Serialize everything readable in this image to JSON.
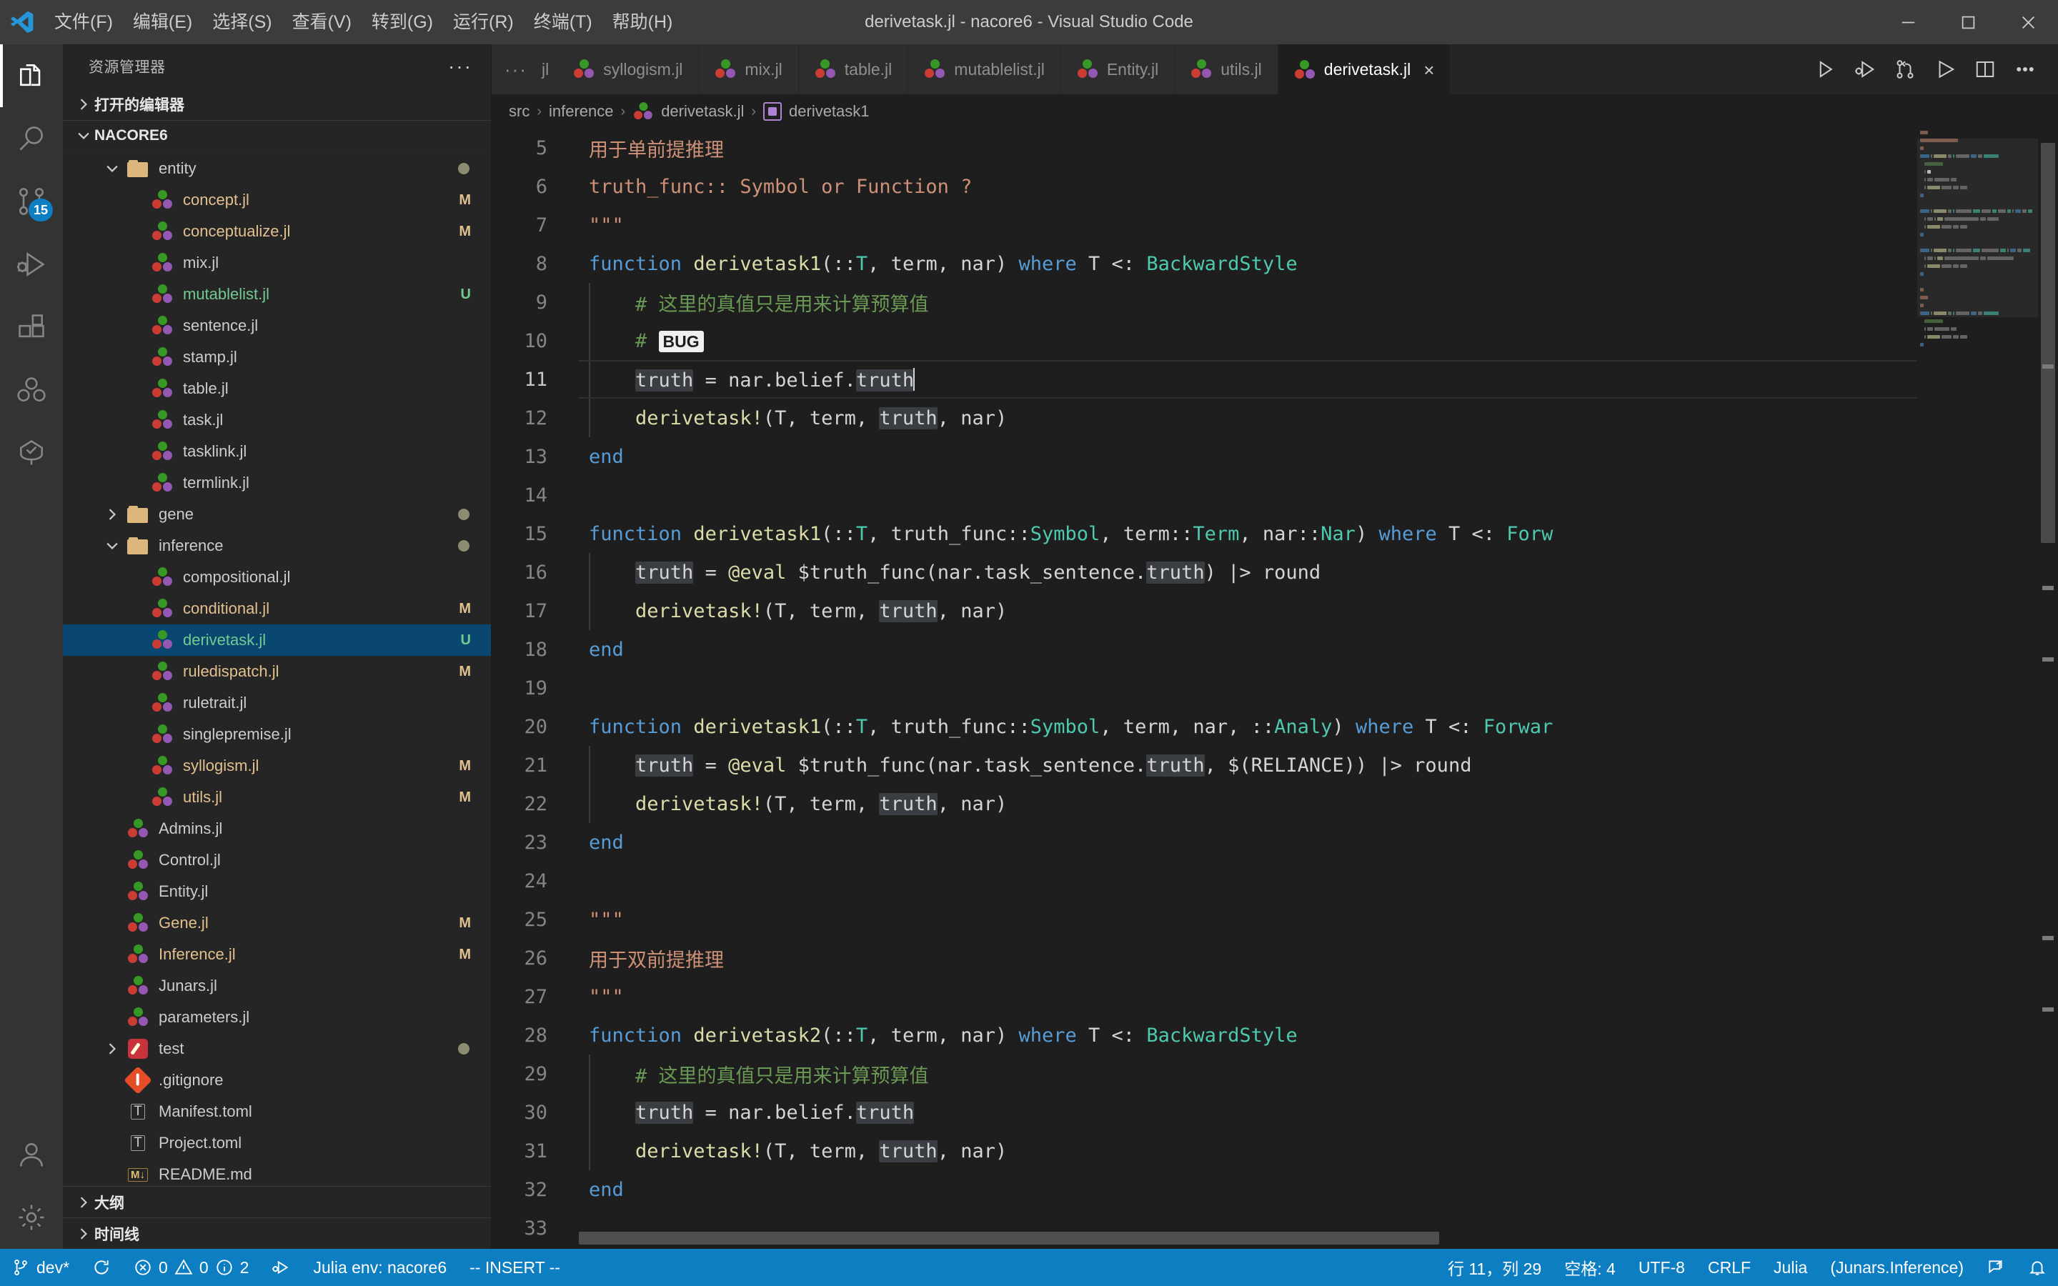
{
  "window": {
    "title": "derivetask.jl - nacore6 - Visual Studio Code",
    "menu": [
      "文件(F)",
      "编辑(E)",
      "选择(S)",
      "查看(V)",
      "转到(G)",
      "运行(R)",
      "终端(T)",
      "帮助(H)"
    ],
    "controls": {
      "minimize": "minimize-icon",
      "maximize": "maximize-icon",
      "close": "close-icon"
    }
  },
  "activity_bar": {
    "items": [
      {
        "name": "explorer",
        "icon": "files-icon",
        "active": true,
        "badge": ""
      },
      {
        "name": "search",
        "icon": "search-icon",
        "active": false,
        "badge": ""
      },
      {
        "name": "source-control",
        "icon": "source-control-icon",
        "active": false,
        "badge": "15"
      },
      {
        "name": "run-and-debug",
        "icon": "run-debug-icon",
        "active": false,
        "badge": ""
      },
      {
        "name": "extensions",
        "icon": "extensions-icon",
        "active": false,
        "badge": ""
      },
      {
        "name": "julia",
        "icon": "julia-icon",
        "active": false,
        "badge": ""
      },
      {
        "name": "testing",
        "icon": "testing-tree-icon",
        "active": false,
        "badge": ""
      }
    ],
    "bottom": [
      {
        "name": "accounts",
        "icon": "account-icon"
      },
      {
        "name": "manage",
        "icon": "gear-icon"
      }
    ]
  },
  "sidebar": {
    "title": "资源管理器",
    "more_actions": "···",
    "open_editors_label": "打开的编辑器",
    "folder_label": "NACORE6",
    "outline_label": "大纲",
    "timeline_label": "时间线",
    "tree": [
      {
        "label": "entity",
        "type": "folder",
        "indent": 1,
        "expanded": true,
        "status": "",
        "dot": true
      },
      {
        "label": "concept.jl",
        "type": "julia",
        "indent": 2,
        "status": "M"
      },
      {
        "label": "conceptualize.jl",
        "type": "julia",
        "indent": 2,
        "status": "M"
      },
      {
        "label": "mix.jl",
        "type": "julia",
        "indent": 2,
        "status": ""
      },
      {
        "label": "mutablelist.jl",
        "type": "julia",
        "indent": 2,
        "status": "U",
        "color": "#73c991"
      },
      {
        "label": "sentence.jl",
        "type": "julia",
        "indent": 2,
        "status": ""
      },
      {
        "label": "stamp.jl",
        "type": "julia",
        "indent": 2,
        "status": ""
      },
      {
        "label": "table.jl",
        "type": "julia",
        "indent": 2,
        "status": ""
      },
      {
        "label": "task.jl",
        "type": "julia",
        "indent": 2,
        "status": ""
      },
      {
        "label": "tasklink.jl",
        "type": "julia",
        "indent": 2,
        "status": ""
      },
      {
        "label": "termlink.jl",
        "type": "julia",
        "indent": 2,
        "status": ""
      },
      {
        "label": "gene",
        "type": "folder",
        "indent": 1,
        "expanded": false,
        "status": "",
        "dot": true
      },
      {
        "label": "inference",
        "type": "folder",
        "indent": 1,
        "expanded": true,
        "status": "",
        "dot": true
      },
      {
        "label": "compositional.jl",
        "type": "julia",
        "indent": 2,
        "status": ""
      },
      {
        "label": "conditional.jl",
        "type": "julia",
        "indent": 2,
        "status": "M"
      },
      {
        "label": "derivetask.jl",
        "type": "julia",
        "indent": 2,
        "status": "U",
        "selected": true,
        "color": "#73c991"
      },
      {
        "label": "ruledispatch.jl",
        "type": "julia",
        "indent": 2,
        "status": "M"
      },
      {
        "label": "ruletrait.jl",
        "type": "julia",
        "indent": 2,
        "status": ""
      },
      {
        "label": "singlepremise.jl",
        "type": "julia",
        "indent": 2,
        "status": ""
      },
      {
        "label": "syllogism.jl",
        "type": "julia",
        "indent": 2,
        "status": "M"
      },
      {
        "label": "utils.jl",
        "type": "julia",
        "indent": 2,
        "status": "M"
      },
      {
        "label": "Admins.jl",
        "type": "julia",
        "indent": 1,
        "status": ""
      },
      {
        "label": "Control.jl",
        "type": "julia",
        "indent": 1,
        "status": ""
      },
      {
        "label": "Entity.jl",
        "type": "julia",
        "indent": 1,
        "status": ""
      },
      {
        "label": "Gene.jl",
        "type": "julia",
        "indent": 1,
        "status": "M"
      },
      {
        "label": "Inference.jl",
        "type": "julia",
        "indent": 1,
        "status": "M"
      },
      {
        "label": "Junars.jl",
        "type": "julia",
        "indent": 1,
        "status": ""
      },
      {
        "label": "parameters.jl",
        "type": "julia",
        "indent": 1,
        "status": ""
      },
      {
        "label": "test",
        "type": "test",
        "indent": 1,
        "expanded": false,
        "status": "",
        "dot": true
      },
      {
        "label": ".gitignore",
        "type": "git",
        "indent": 1,
        "status": ""
      },
      {
        "label": "Manifest.toml",
        "type": "toml",
        "indent": 1,
        "status": ""
      },
      {
        "label": "Project.toml",
        "type": "toml",
        "indent": 1,
        "status": ""
      },
      {
        "label": "README.md",
        "type": "md",
        "indent": 1,
        "status": ""
      }
    ]
  },
  "tabs": {
    "overflow_indicator": "···",
    "truncated_tab": "jl",
    "items": [
      {
        "label": "syllogism.jl",
        "active": false
      },
      {
        "label": "mix.jl",
        "active": false
      },
      {
        "label": "table.jl",
        "active": false
      },
      {
        "label": "mutablelist.jl",
        "active": false
      },
      {
        "label": "Entity.jl",
        "active": false
      },
      {
        "label": "utils.jl",
        "active": false
      },
      {
        "label": "derivetask.jl",
        "active": true,
        "close": "×"
      }
    ],
    "actions": [
      {
        "name": "run-file-button",
        "icon": "play-icon"
      },
      {
        "name": "debug-file-button",
        "icon": "debug-play-icon"
      },
      {
        "name": "julia-repl-button",
        "icon": "source-control-icon"
      },
      {
        "name": "run-or-play-button",
        "icon": "play-filled-icon"
      },
      {
        "name": "split-editor-button",
        "icon": "split-editor-icon"
      },
      {
        "name": "more-actions-button",
        "icon": "ellipsis-icon"
      }
    ]
  },
  "breadcrumb": {
    "parts": [
      "src",
      "inference",
      "derivetask.jl",
      "derivetask1"
    ],
    "separator": "›"
  },
  "editor": {
    "first_line": 5,
    "cursor_line": 11,
    "lines": [
      {
        "n": 5,
        "tokens": [
          {
            "t": "用于单前提推理",
            "c": "str"
          }
        ]
      },
      {
        "n": 6,
        "tokens": [
          {
            "t": "truth_func:: Symbol or Function ?",
            "c": "str"
          }
        ]
      },
      {
        "n": 7,
        "tokens": [
          {
            "t": "\"\"\"",
            "c": "str"
          }
        ]
      },
      {
        "n": 8,
        "tokens": [
          {
            "t": "function",
            "c": "k"
          },
          {
            "t": " ",
            "c": "pl"
          },
          {
            "t": "derivetask1",
            "c": "fn"
          },
          {
            "t": "(::",
            "c": "pl"
          },
          {
            "t": "T",
            "c": "ty"
          },
          {
            "t": ", term, nar) ",
            "c": "pl"
          },
          {
            "t": "where",
            "c": "k"
          },
          {
            "t": " T <: ",
            "c": "pl"
          },
          {
            "t": "BackwardStyle",
            "c": "ty"
          }
        ]
      },
      {
        "n": 9,
        "indent": true,
        "tokens": [
          {
            "t": "    # 这里的真值只是用来计算预算值",
            "c": "cm"
          }
        ]
      },
      {
        "n": 10,
        "indent": true,
        "tokens": [
          {
            "t": "    # ",
            "c": "cm"
          },
          {
            "t": "BUG",
            "c": "bugtag"
          }
        ]
      },
      {
        "n": 11,
        "indent": true,
        "cursor": true,
        "tokens": [
          {
            "t": "    ",
            "c": "pl"
          },
          {
            "t": "truth",
            "c": "pl hl"
          },
          {
            "t": " = nar.belief.",
            "c": "pl"
          },
          {
            "t": "truth",
            "c": "pl hl"
          },
          {
            "t": "|CARET|",
            "c": "caret"
          }
        ]
      },
      {
        "n": 12,
        "indent": true,
        "tokens": [
          {
            "t": "    ",
            "c": "pl"
          },
          {
            "t": "derivetask!",
            "c": "fn"
          },
          {
            "t": "(T, term, ",
            "c": "pl"
          },
          {
            "t": "truth",
            "c": "pl hl"
          },
          {
            "t": ", nar)",
            "c": "pl"
          }
        ]
      },
      {
        "n": 13,
        "tokens": [
          {
            "t": "end",
            "c": "k"
          }
        ]
      },
      {
        "n": 14,
        "tokens": []
      },
      {
        "n": 15,
        "tokens": [
          {
            "t": "function",
            "c": "k"
          },
          {
            "t": " ",
            "c": "pl"
          },
          {
            "t": "derivetask1",
            "c": "fn"
          },
          {
            "t": "(::",
            "c": "pl"
          },
          {
            "t": "T",
            "c": "ty"
          },
          {
            "t": ", truth_func::",
            "c": "pl"
          },
          {
            "t": "Symbol",
            "c": "ty"
          },
          {
            "t": ", term::",
            "c": "pl"
          },
          {
            "t": "Term",
            "c": "ty"
          },
          {
            "t": ", nar::",
            "c": "pl"
          },
          {
            "t": "Nar",
            "c": "ty"
          },
          {
            "t": ") ",
            "c": "pl"
          },
          {
            "t": "where",
            "c": "k"
          },
          {
            "t": " T <: ",
            "c": "pl"
          },
          {
            "t": "Forw",
            "c": "ty"
          }
        ]
      },
      {
        "n": 16,
        "indent": true,
        "tokens": [
          {
            "t": "    ",
            "c": "pl"
          },
          {
            "t": "truth",
            "c": "pl hl"
          },
          {
            "t": " = ",
            "c": "pl"
          },
          {
            "t": "@eval",
            "c": "mac"
          },
          {
            "t": " $truth_func(nar.task_sentence.",
            "c": "pl"
          },
          {
            "t": "truth",
            "c": "pl hl"
          },
          {
            "t": ") |> round",
            "c": "pl"
          }
        ]
      },
      {
        "n": 17,
        "indent": true,
        "tokens": [
          {
            "t": "    ",
            "c": "pl"
          },
          {
            "t": "derivetask!",
            "c": "fn"
          },
          {
            "t": "(T, term, ",
            "c": "pl"
          },
          {
            "t": "truth",
            "c": "pl hl"
          },
          {
            "t": ", nar)",
            "c": "pl"
          }
        ]
      },
      {
        "n": 18,
        "tokens": [
          {
            "t": "end",
            "c": "k"
          }
        ]
      },
      {
        "n": 19,
        "tokens": []
      },
      {
        "n": 20,
        "tokens": [
          {
            "t": "function",
            "c": "k"
          },
          {
            "t": " ",
            "c": "pl"
          },
          {
            "t": "derivetask1",
            "c": "fn"
          },
          {
            "t": "(::",
            "c": "pl"
          },
          {
            "t": "T",
            "c": "ty"
          },
          {
            "t": ", truth_func::",
            "c": "pl"
          },
          {
            "t": "Symbol",
            "c": "ty"
          },
          {
            "t": ", term, nar, ::",
            "c": "pl"
          },
          {
            "t": "Analy",
            "c": "ty"
          },
          {
            "t": ") ",
            "c": "pl"
          },
          {
            "t": "where",
            "c": "k"
          },
          {
            "t": " T <: ",
            "c": "pl"
          },
          {
            "t": "Forwar",
            "c": "ty"
          }
        ]
      },
      {
        "n": 21,
        "indent": true,
        "tokens": [
          {
            "t": "    ",
            "c": "pl"
          },
          {
            "t": "truth",
            "c": "pl hl"
          },
          {
            "t": " = ",
            "c": "pl"
          },
          {
            "t": "@eval",
            "c": "mac"
          },
          {
            "t": " $truth_func(nar.task_sentence.",
            "c": "pl"
          },
          {
            "t": "truth",
            "c": "pl hl"
          },
          {
            "t": ", $(RELIANCE)) |> round",
            "c": "pl"
          }
        ]
      },
      {
        "n": 22,
        "indent": true,
        "tokens": [
          {
            "t": "    ",
            "c": "pl"
          },
          {
            "t": "derivetask!",
            "c": "fn"
          },
          {
            "t": "(T, term, ",
            "c": "pl"
          },
          {
            "t": "truth",
            "c": "pl hl"
          },
          {
            "t": ", nar)",
            "c": "pl"
          }
        ]
      },
      {
        "n": 23,
        "tokens": [
          {
            "t": "end",
            "c": "k"
          }
        ]
      },
      {
        "n": 24,
        "tokens": []
      },
      {
        "n": 25,
        "tokens": [
          {
            "t": "\"\"\"",
            "c": "str"
          }
        ]
      },
      {
        "n": 26,
        "tokens": [
          {
            "t": "用于双前提推理",
            "c": "str"
          }
        ]
      },
      {
        "n": 27,
        "tokens": [
          {
            "t": "\"\"\"",
            "c": "str"
          }
        ]
      },
      {
        "n": 28,
        "tokens": [
          {
            "t": "function",
            "c": "k"
          },
          {
            "t": " ",
            "c": "pl"
          },
          {
            "t": "derivetask2",
            "c": "fn"
          },
          {
            "t": "(::",
            "c": "pl"
          },
          {
            "t": "T",
            "c": "ty"
          },
          {
            "t": ", term, nar) ",
            "c": "pl"
          },
          {
            "t": "where",
            "c": "k"
          },
          {
            "t": " T <: ",
            "c": "pl"
          },
          {
            "t": "BackwardStyle",
            "c": "ty"
          }
        ]
      },
      {
        "n": 29,
        "indent": true,
        "tokens": [
          {
            "t": "    # 这里的真值只是用来计算预算值",
            "c": "cm"
          }
        ]
      },
      {
        "n": 30,
        "indent": true,
        "tokens": [
          {
            "t": "    ",
            "c": "pl"
          },
          {
            "t": "truth",
            "c": "pl hl"
          },
          {
            "t": " = nar.belief.",
            "c": "pl"
          },
          {
            "t": "truth",
            "c": "pl hl"
          }
        ]
      },
      {
        "n": 31,
        "indent": true,
        "tokens": [
          {
            "t": "    ",
            "c": "pl"
          },
          {
            "t": "derivetask!",
            "c": "fn"
          },
          {
            "t": "(T, term, ",
            "c": "pl"
          },
          {
            "t": "truth",
            "c": "pl hl"
          },
          {
            "t": ", nar)",
            "c": "pl"
          }
        ]
      },
      {
        "n": 32,
        "tokens": [
          {
            "t": "end",
            "c": "k"
          }
        ]
      },
      {
        "n": 33,
        "tokens": []
      }
    ]
  },
  "statusbar": {
    "left": [
      {
        "name": "remote-branch",
        "icon": "branch-icon",
        "text": "dev*"
      },
      {
        "name": "sync-changes",
        "icon": "sync-icon",
        "text": ""
      },
      {
        "name": "problems",
        "icon": "problems-icon",
        "text": "0  0  2",
        "errors": "0",
        "warnings": "0",
        "infos": "2"
      },
      {
        "name": "julia-debug",
        "icon": "debug-play-icon",
        "text": ""
      },
      {
        "name": "julia-env",
        "icon": "",
        "text": "Julia env: nacore6"
      },
      {
        "name": "vim-mode",
        "icon": "",
        "text": "-- INSERT --"
      }
    ],
    "right": [
      {
        "name": "cursor-position",
        "text": "行 11，列 29"
      },
      {
        "name": "indentation",
        "text": "空格: 4"
      },
      {
        "name": "encoding",
        "text": "UTF-8"
      },
      {
        "name": "eol",
        "text": "CRLF"
      },
      {
        "name": "language-mode",
        "text": "Julia"
      },
      {
        "name": "julia-module",
        "text": "(Junars.Inference)"
      },
      {
        "name": "feedback",
        "icon": "feedback-icon",
        "text": ""
      },
      {
        "name": "notifications",
        "icon": "bell-icon",
        "text": ""
      }
    ]
  }
}
